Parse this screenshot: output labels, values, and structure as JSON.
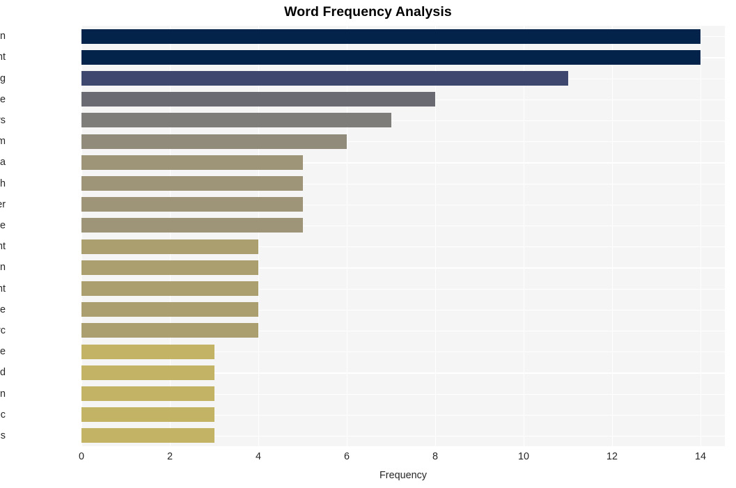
{
  "chart_data": {
    "type": "bar",
    "orientation": "horizontal",
    "title": "Word Frequency Analysis",
    "xlabel": "Frequency",
    "ylabel": "",
    "categories": [
      "human",
      "right",
      "xinjiang",
      "state",
      "uyghurs",
      "muslim",
      "china",
      "high",
      "commissioner",
      "release",
      "department",
      "action",
      "assessment",
      "continue",
      "prc",
      "unite",
      "end",
      "repression",
      "ethnic",
      "religious"
    ],
    "values": [
      14,
      14,
      11,
      8,
      7,
      6,
      5,
      5,
      5,
      5,
      4,
      4,
      4,
      4,
      4,
      3,
      3,
      3,
      3,
      3
    ],
    "bar_colors": [
      "#04234b",
      "#04234b",
      "#3e476e",
      "#6a6b72",
      "#7e7d79",
      "#918b7c",
      "#9e9578",
      "#9e9578",
      "#9e9578",
      "#9e9578",
      "#ab9f6f",
      "#ab9f6f",
      "#ab9f6f",
      "#ab9f6f",
      "#ab9f6f",
      "#c3b465",
      "#c3b465",
      "#c3b465",
      "#c3b465",
      "#c3b465"
    ],
    "xlim": [
      0,
      14.55
    ],
    "xticks": [
      0,
      2,
      4,
      6,
      8,
      10,
      12,
      14
    ],
    "xtick_labels": [
      "0",
      "2",
      "4",
      "6",
      "8",
      "10",
      "12",
      "14"
    ],
    "grid": true,
    "grid_color": "#ffffff",
    "plot_background": "#f5f5f5",
    "figure_background": "#ffffff",
    "legend": null
  }
}
